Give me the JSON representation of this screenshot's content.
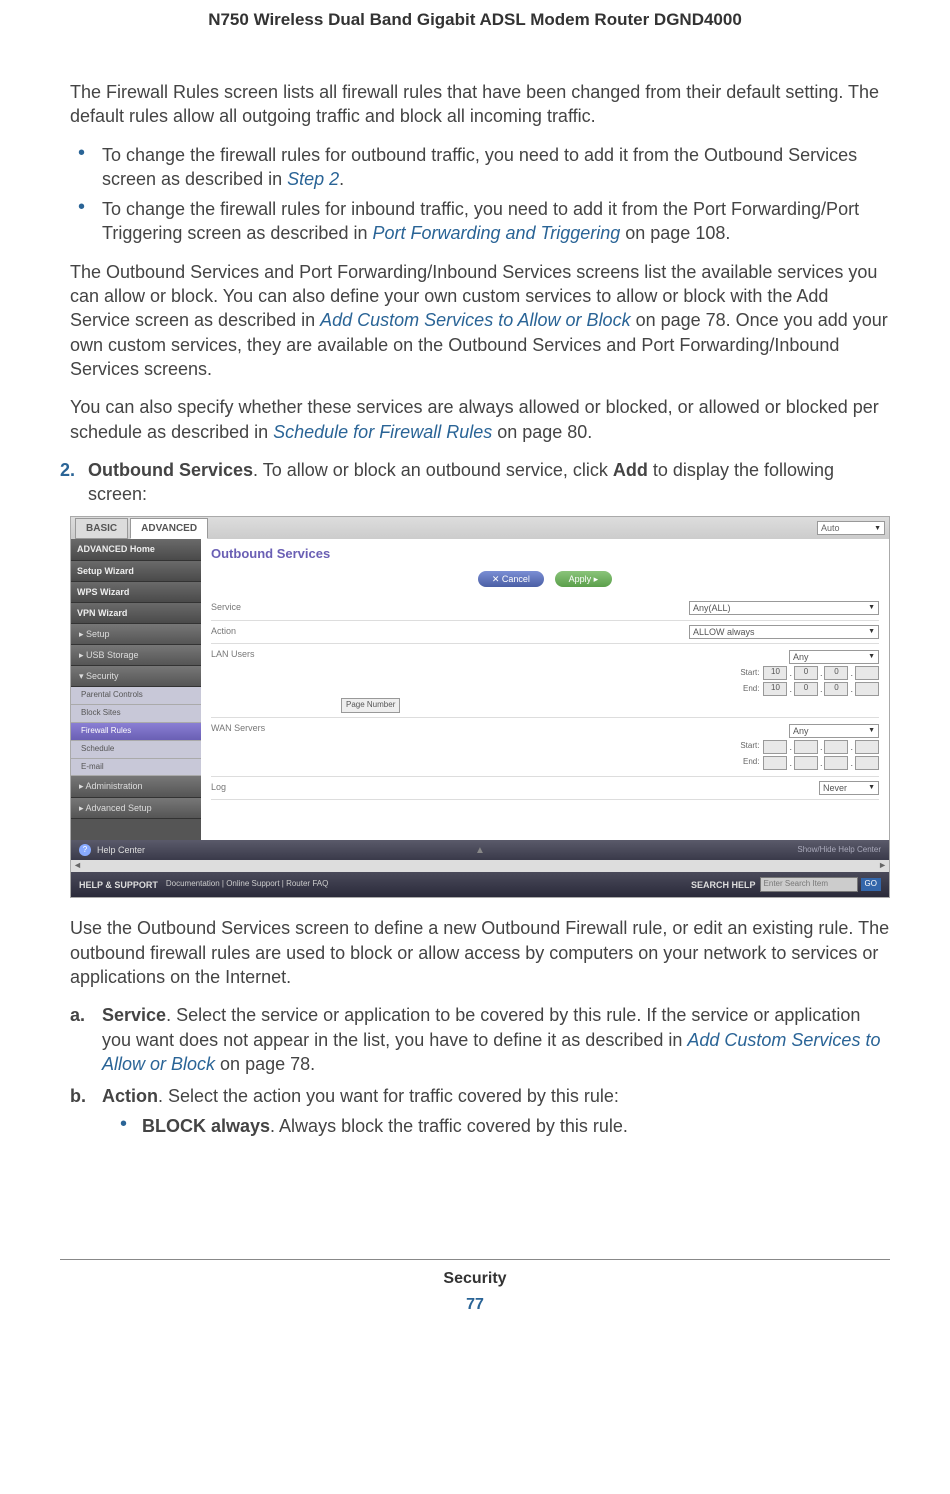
{
  "header": {
    "title": "N750 Wireless Dual Band Gigabit ADSL Modem Router DGND4000"
  },
  "p1": "The Firewall Rules screen lists all firewall rules that have been changed from their default setting. The default rules allow all outgoing traffic and block all incoming traffic.",
  "bul1a_pre": "To change the firewall rules for outbound traffic, you need to add it from the Outbound Services screen as described in ",
  "bul1a_link": "Step 2",
  "bul1a_post": ".",
  "bul1b_pre": "To change the firewall rules for inbound traffic, you need to add it from the Port Forwarding/Port Triggering screen as described in ",
  "bul1b_link": "Port Forwarding and Triggering",
  "bul1b_post": " on page 108.",
  "p2_pre": "The Outbound Services and Port Forwarding/Inbound Services screens list the available services you can allow or block. You can also define your own custom services to allow or block with the Add Service screen as described in ",
  "p2_link": "Add Custom Services to Allow or Block",
  "p2_post": " on page 78. Once you add your own custom services, they are available on the Outbound Services and Port Forwarding/Inbound Services screens.",
  "p3_pre": "You can also specify whether these services are always allowed or blocked, or allowed or blocked per schedule as described in ",
  "p3_link": "Schedule for Firewall Rules",
  "p3_post": " on page 80.",
  "step2": {
    "num": "2.",
    "bold1": "Outbound Services",
    "mid": ". To allow or block an outbound service, click ",
    "bold2": "Add",
    "post": " to display the following screen:"
  },
  "shot": {
    "tabs": {
      "basic": "BASIC",
      "advanced": "ADVANCED",
      "auto": "Auto"
    },
    "sidebar": {
      "home": "ADVANCED Home",
      "setupwiz": "Setup Wizard",
      "wps": "WPS Wizard",
      "vpn": "VPN Wizard",
      "setup": "▸ Setup",
      "usb": "▸ USB Storage",
      "security": "▾ Security",
      "sub_parental": "Parental Controls",
      "sub_block": "Block Sites",
      "sub_firewall": "Firewall Rules",
      "sub_schedule": "Schedule",
      "sub_email": "E-mail",
      "admin": "▸ Administration",
      "advsetup": "▸ Advanced Setup"
    },
    "main": {
      "title": "Outbound Services",
      "cancel": "✕    Cancel",
      "apply": "Apply    ▸",
      "row_service": "Service",
      "row_action": "Action",
      "row_lan": "LAN Users",
      "row_wan": "WAN Servers",
      "row_log": "Log",
      "sel_service": "Any(ALL)",
      "sel_action": "ALLOW always",
      "sel_any": "Any",
      "sel_log": "Never",
      "start": "Start:",
      "end": "End:",
      "oct1": "10",
      "oct2": "0",
      "oct3": "0",
      "pagebtn": "Page Number"
    },
    "helpbar": {
      "q": "?",
      "label": "Help Center",
      "arrow": "▲",
      "hide": "Show/Hide Help Center"
    },
    "support": {
      "title": "HELP & SUPPORT",
      "links": "Documentation | Online Support | Router FAQ",
      "searchlbl": "SEARCH HELP",
      "placeholder": "Enter Search Item",
      "go": "GO"
    }
  },
  "p4": "Use the Outbound Services screen to define a new Outbound Firewall rule, or edit an existing rule. The outbound firewall rules are used to block or allow access by computers on your network to services or applications on the Internet.",
  "alpha": {
    "a": {
      "label": "a.",
      "bold": "Service",
      "pre": ". Select the service or application to be covered by this rule. If the service or application you want does not appear in the list, you have to define it as described in ",
      "link": "Add Custom Services to Allow or Block",
      "post": " on page 78."
    },
    "b": {
      "label": "b.",
      "bold": "Action",
      "text": ". Select the action you want for traffic covered by this rule:",
      "sub": {
        "bold": "BLOCK always",
        "text": ". Always block the traffic covered by this rule."
      }
    }
  },
  "footer": {
    "section": "Security",
    "page": "77"
  }
}
